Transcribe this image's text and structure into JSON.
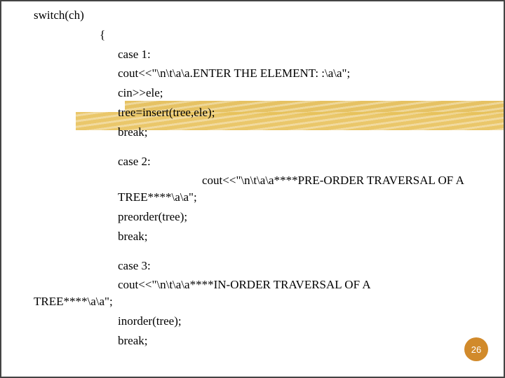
{
  "slide": {
    "lines": {
      "l1": "switch(ch)",
      "l2": "{",
      "l3": "case 1:",
      "l4": "cout<<\"\\n\\t\\a\\a.ENTER THE ELEMENT: :\\a\\a\";",
      "l5": "cin>>ele;",
      "l6": "tree=insert(tree,ele);",
      "l7": "break;",
      "l8": "case 2:",
      "l9": "cout<<\"\\n\\t\\a\\a****PRE-ORDER TRAVERSAL OF A TREE****\\a\\a\";",
      "l10": "preorder(tree);",
      "l11": "break;",
      "l12": "case 3:",
      "l13": "cout<<\"\\n\\t\\a\\a****IN-ORDER TRAVERSAL OF A TREE****\\a\\a\";",
      "l14": "inorder(tree);",
      "l15": "break;"
    },
    "page_number": "26"
  }
}
